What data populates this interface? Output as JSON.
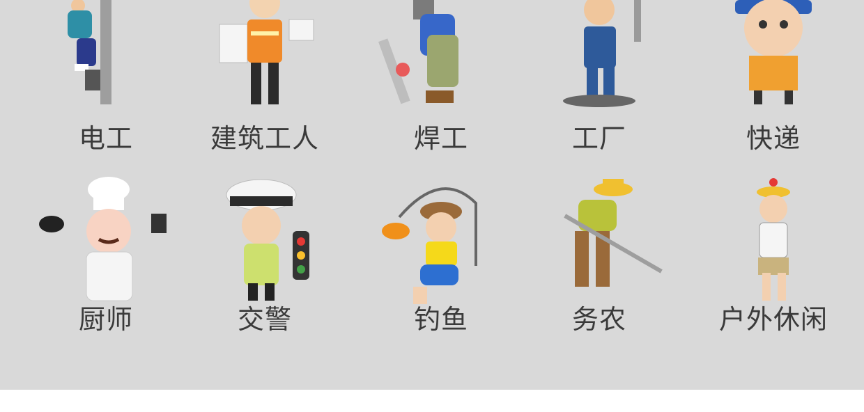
{
  "jobs": [
    {
      "label": "电工",
      "icon": "electrician-icon"
    },
    {
      "label": "建筑工人",
      "icon": "construction-worker-icon"
    },
    {
      "label": "焊工",
      "icon": "welder-icon"
    },
    {
      "label": "工厂",
      "icon": "factory-worker-icon"
    },
    {
      "label": "快递",
      "icon": "courier-icon"
    },
    {
      "label": "厨师",
      "icon": "chef-icon"
    },
    {
      "label": "交警",
      "icon": "traffic-police-icon"
    },
    {
      "label": "钓鱼",
      "icon": "fishing-icon"
    },
    {
      "label": "务农",
      "icon": "farmer-icon"
    },
    {
      "label": "户外休闲",
      "icon": "outdoor-leisure-icon"
    }
  ],
  "colors": {
    "panel_background": "#d9d9d9",
    "page_background": "#ffffff",
    "label_text": "#3a3a3a"
  }
}
